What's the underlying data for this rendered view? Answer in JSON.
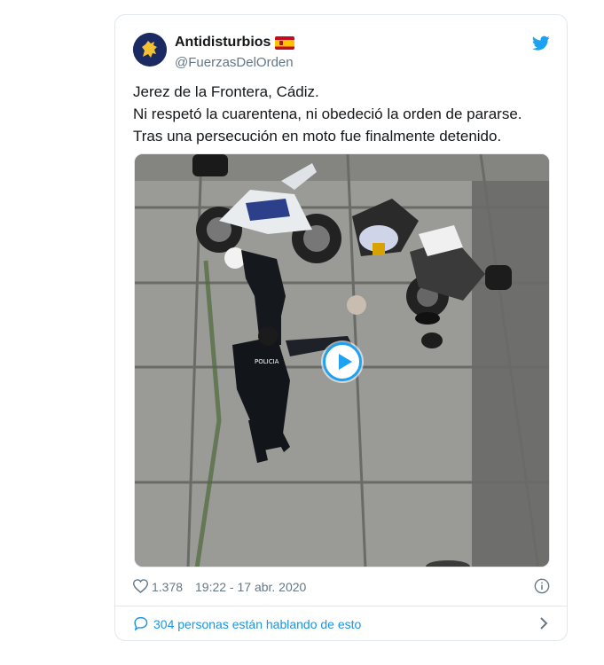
{
  "author": {
    "display_name": "Antidisturbios",
    "handle": "@FuerzasDelOrden",
    "flag": "spain-flag-emoji",
    "avatar_colors": {
      "background": "#1b2a63",
      "emblem": "#f2c230"
    }
  },
  "tweet": {
    "lines": [
      "Jerez de la Frontera, Cádiz.",
      "Ni respetó la cuarentena, ni obedeció la orden de pararse.",
      "Tras una persecución en moto fue finalmente detenido."
    ]
  },
  "media": {
    "type": "video",
    "play_icon": "play-icon"
  },
  "meta": {
    "likes": "1.378",
    "timestamp": "19:22 - 17 abr. 2020"
  },
  "conversation": {
    "text": "304 personas están hablando de esto"
  },
  "colors": {
    "twitter_blue": "#1da1f2",
    "link_blue": "#1b95e0",
    "text": "#14171a",
    "muted": "#657786",
    "border": "#e1e8ed"
  }
}
